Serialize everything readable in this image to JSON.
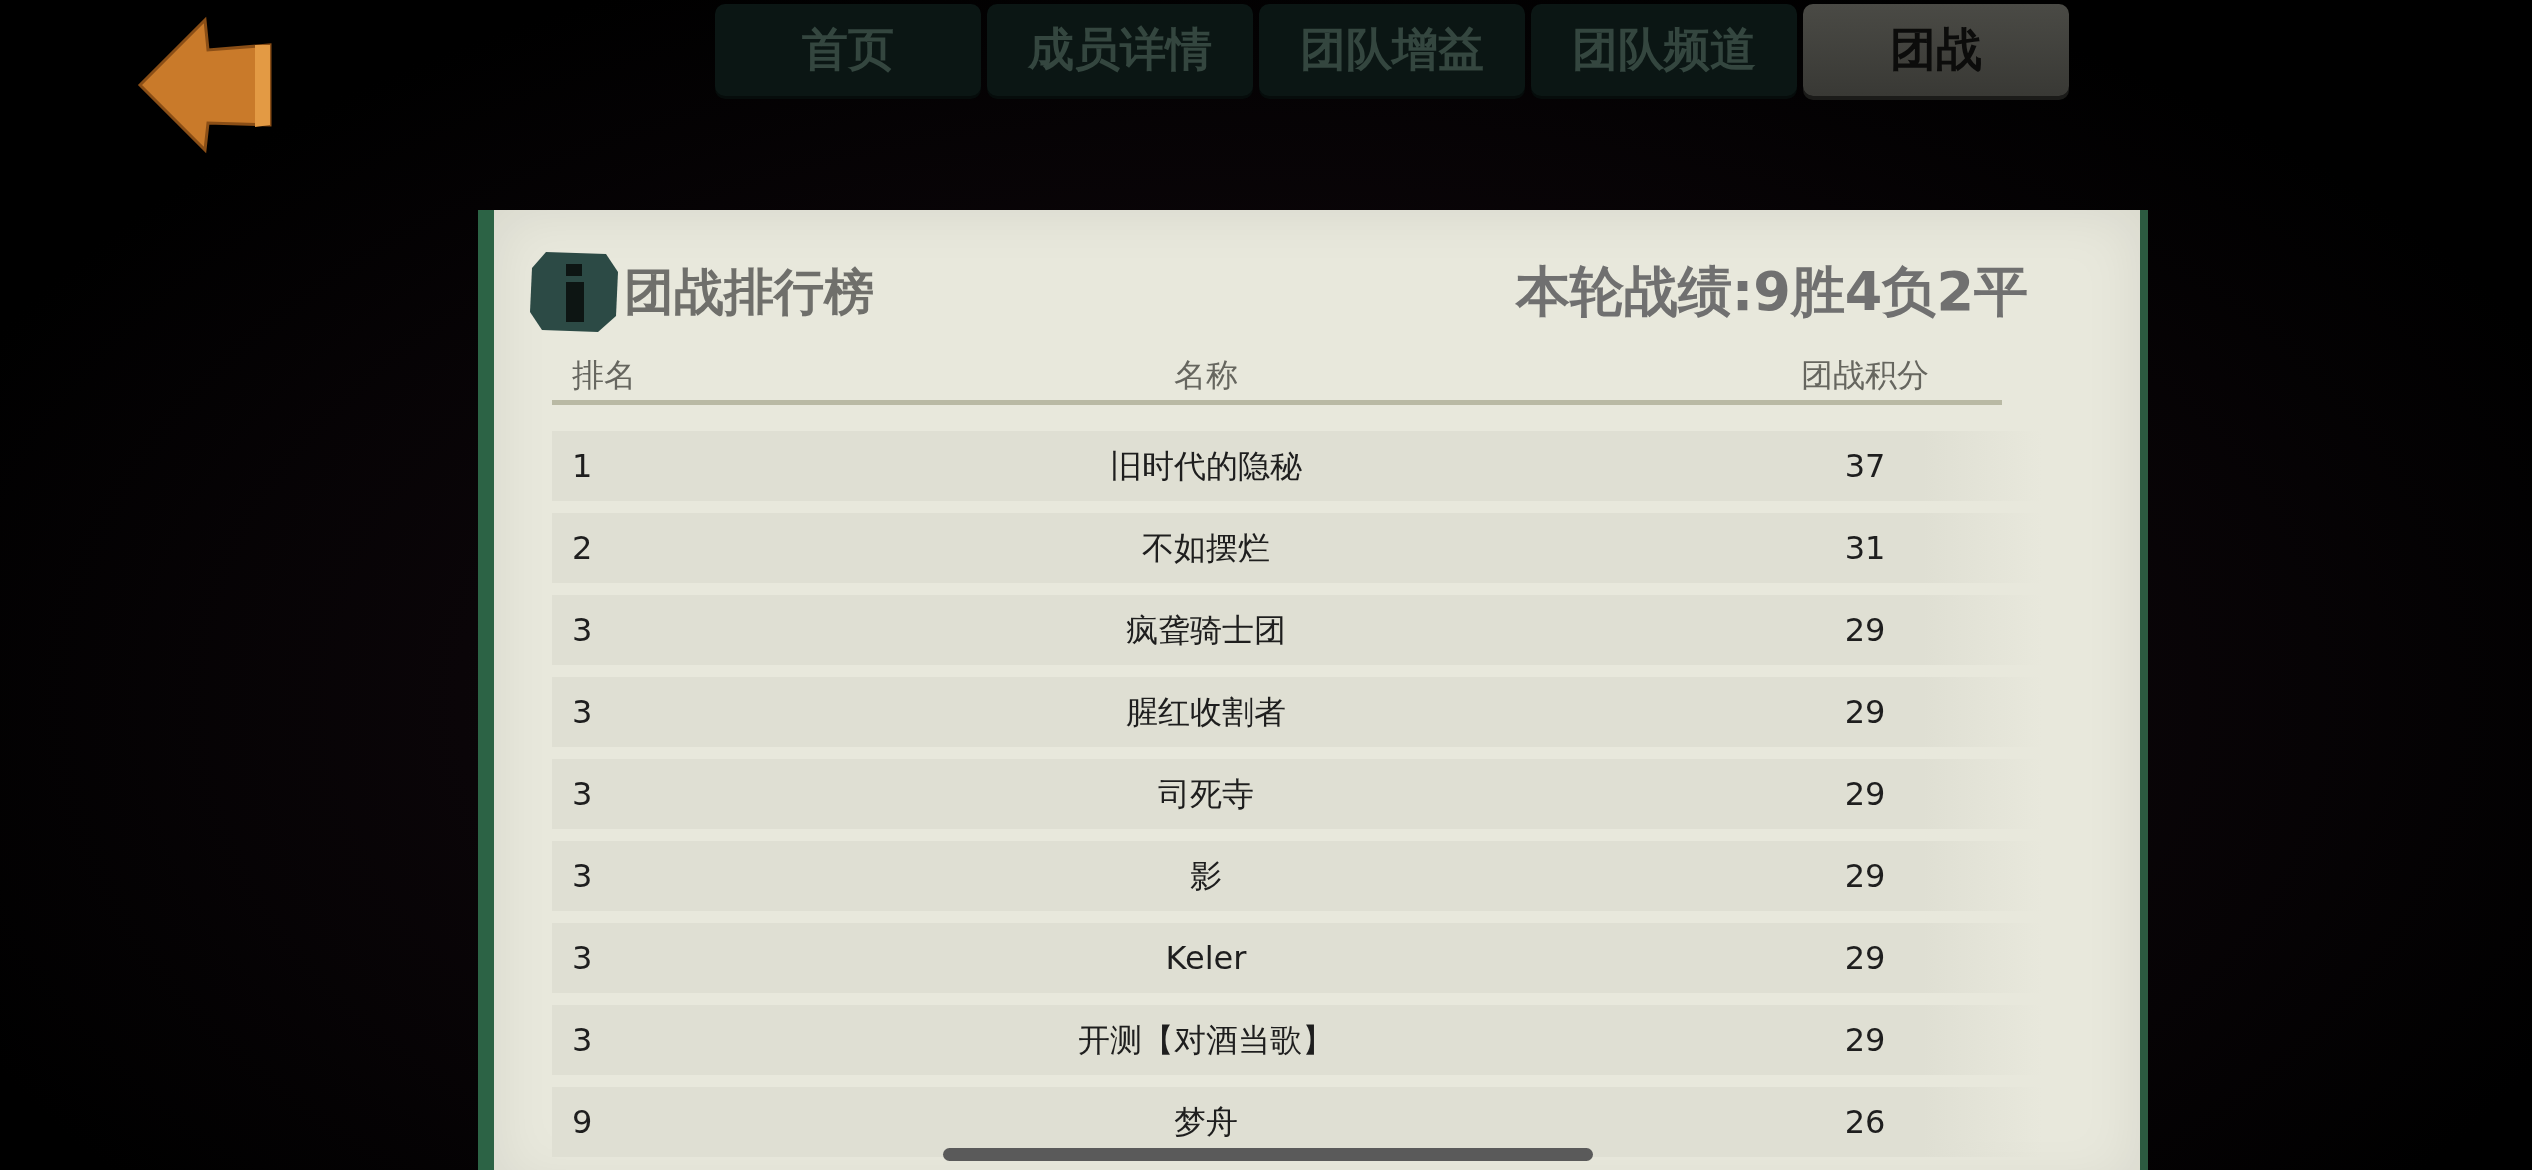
{
  "tabs": [
    {
      "label": "首页",
      "selected": false
    },
    {
      "label": "成员详情",
      "selected": false
    },
    {
      "label": "团队增益",
      "selected": false
    },
    {
      "label": "团队频道",
      "selected": false
    },
    {
      "label": "团战",
      "selected": true
    }
  ],
  "panel": {
    "title": "团战排行榜",
    "record": "本轮战绩:9胜4负2平",
    "columns": [
      "排名",
      "名称",
      "团战积分"
    ],
    "rows": [
      {
        "rank": "1",
        "name": "旧时代的隐秘",
        "score": "37"
      },
      {
        "rank": "2",
        "name": "不如摆烂",
        "score": "31"
      },
      {
        "rank": "3",
        "name": "疯聋骑士团",
        "score": "29"
      },
      {
        "rank": "3",
        "name": "腥红收割者",
        "score": "29"
      },
      {
        "rank": "3",
        "name": "司死寺",
        "score": "29"
      },
      {
        "rank": "3",
        "name": "影",
        "score": "29"
      },
      {
        "rank": "3",
        "name": "Keler",
        "score": "29"
      },
      {
        "rank": "3",
        "name": "开测【对酒当歌】",
        "score": "29"
      },
      {
        "rank": "9",
        "name": "梦舟",
        "score": "26"
      }
    ]
  }
}
